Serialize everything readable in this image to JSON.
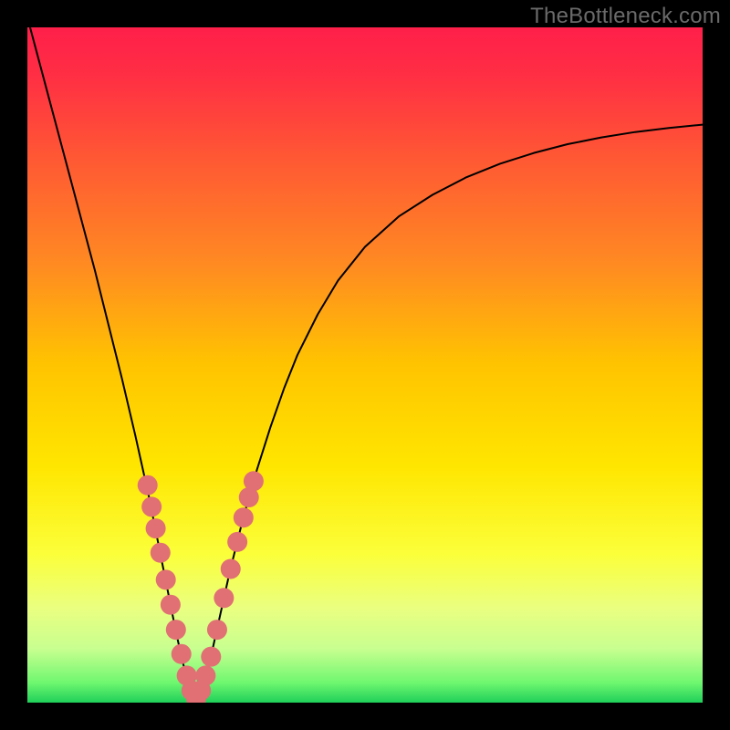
{
  "watermark": "TheBottleneck.com",
  "chart_data": {
    "type": "line",
    "title": "",
    "xlabel": "",
    "ylabel": "",
    "xlim": [
      0,
      1
    ],
    "ylim": [
      0,
      1
    ],
    "background_gradient": {
      "stops": [
        {
          "offset": 0.0,
          "color": "#ff1f4a"
        },
        {
          "offset": 0.07,
          "color": "#ff2e44"
        },
        {
          "offset": 0.2,
          "color": "#ff5a33"
        },
        {
          "offset": 0.35,
          "color": "#ff8a22"
        },
        {
          "offset": 0.5,
          "color": "#ffc400"
        },
        {
          "offset": 0.65,
          "color": "#ffe600"
        },
        {
          "offset": 0.78,
          "color": "#fbff3a"
        },
        {
          "offset": 0.86,
          "color": "#eaff80"
        },
        {
          "offset": 0.92,
          "color": "#c8ff90"
        },
        {
          "offset": 0.97,
          "color": "#70f770"
        },
        {
          "offset": 1.0,
          "color": "#1fd05a"
        }
      ]
    },
    "series": [
      {
        "name": "bottleneck-curve",
        "x": [
          0.0,
          0.02,
          0.04,
          0.06,
          0.08,
          0.1,
          0.12,
          0.14,
          0.16,
          0.18,
          0.2,
          0.21,
          0.22,
          0.23,
          0.24,
          0.245,
          0.25,
          0.255,
          0.26,
          0.27,
          0.28,
          0.3,
          0.32,
          0.34,
          0.36,
          0.38,
          0.4,
          0.43,
          0.46,
          0.5,
          0.55,
          0.6,
          0.65,
          0.7,
          0.75,
          0.8,
          0.85,
          0.9,
          0.95,
          1.0
        ],
        "y": [
          1.015,
          0.94,
          0.865,
          0.79,
          0.715,
          0.64,
          0.56,
          0.48,
          0.395,
          0.305,
          0.205,
          0.155,
          0.105,
          0.06,
          0.025,
          0.012,
          0.005,
          0.012,
          0.025,
          0.06,
          0.105,
          0.195,
          0.275,
          0.345,
          0.408,
          0.465,
          0.515,
          0.575,
          0.625,
          0.675,
          0.72,
          0.752,
          0.778,
          0.798,
          0.814,
          0.827,
          0.837,
          0.845,
          0.851,
          0.856
        ]
      }
    ],
    "scatter": [
      {
        "name": "left-branch-dots",
        "color": "#e07074",
        "points": [
          {
            "x": 0.178,
            "y": 0.322
          },
          {
            "x": 0.184,
            "y": 0.29
          },
          {
            "x": 0.19,
            "y": 0.258
          },
          {
            "x": 0.197,
            "y": 0.222
          },
          {
            "x": 0.205,
            "y": 0.182
          },
          {
            "x": 0.212,
            "y": 0.145
          },
          {
            "x": 0.22,
            "y": 0.108
          },
          {
            "x": 0.228,
            "y": 0.072
          },
          {
            "x": 0.236,
            "y": 0.04
          },
          {
            "x": 0.243,
            "y": 0.018
          },
          {
            "x": 0.25,
            "y": 0.006
          }
        ]
      },
      {
        "name": "right-branch-dots",
        "color": "#e07074",
        "points": [
          {
            "x": 0.257,
            "y": 0.018
          },
          {
            "x": 0.264,
            "y": 0.04
          },
          {
            "x": 0.272,
            "y": 0.068
          },
          {
            "x": 0.281,
            "y": 0.108
          },
          {
            "x": 0.291,
            "y": 0.155
          },
          {
            "x": 0.301,
            "y": 0.198
          },
          {
            "x": 0.311,
            "y": 0.238
          },
          {
            "x": 0.32,
            "y": 0.274
          },
          {
            "x": 0.328,
            "y": 0.304
          },
          {
            "x": 0.335,
            "y": 0.328
          }
        ]
      }
    ]
  }
}
